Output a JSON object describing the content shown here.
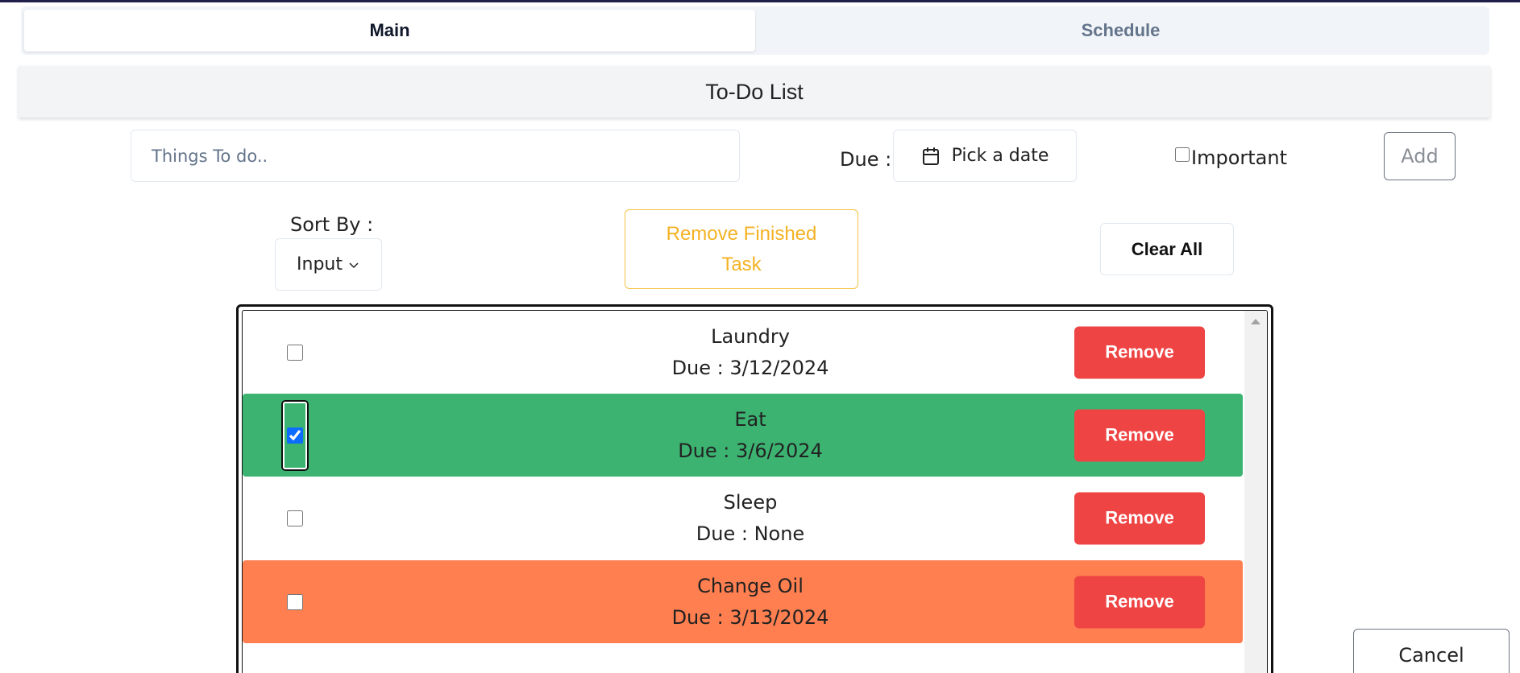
{
  "tabs": [
    {
      "label": "Main",
      "active": true
    },
    {
      "label": "Schedule",
      "active": false
    }
  ],
  "header": {
    "title": "To-Do List"
  },
  "form": {
    "todo_placeholder": "Things To do..",
    "todo_value": "",
    "due_label": "Due :",
    "date_button_label": "Pick a date",
    "date_icon": "calendar-icon",
    "important_label": "Important",
    "important_checked": false,
    "add_label": "Add"
  },
  "controls": {
    "sort_label": "Sort By :",
    "sort_value": "Input",
    "remove_finished_label": "Remove Finished Task",
    "remove_finished_color": "#f4b224",
    "clear_all_label": "Clear All"
  },
  "tasks": [
    {
      "name": "Laundry",
      "due": "Due : 3/12/2024",
      "checked": false,
      "row_color": "#ffffff",
      "remove_label": "Remove"
    },
    {
      "name": "Eat",
      "due": "Due : 3/6/2024",
      "checked": true,
      "row_color": "#3cb371",
      "remove_label": "Remove"
    },
    {
      "name": "Sleep",
      "due": "Due : None",
      "checked": false,
      "row_color": "#ffffff",
      "remove_label": "Remove"
    },
    {
      "name": "Change Oil",
      "due": "Due : 3/13/2024",
      "checked": false,
      "row_color": "#ff7f50",
      "remove_label": "Remove"
    }
  ],
  "colors": {
    "finished": "#3cb371",
    "important": "#ff7f50",
    "remove_button": "#ef4444"
  },
  "cancel_label": "Cancel"
}
